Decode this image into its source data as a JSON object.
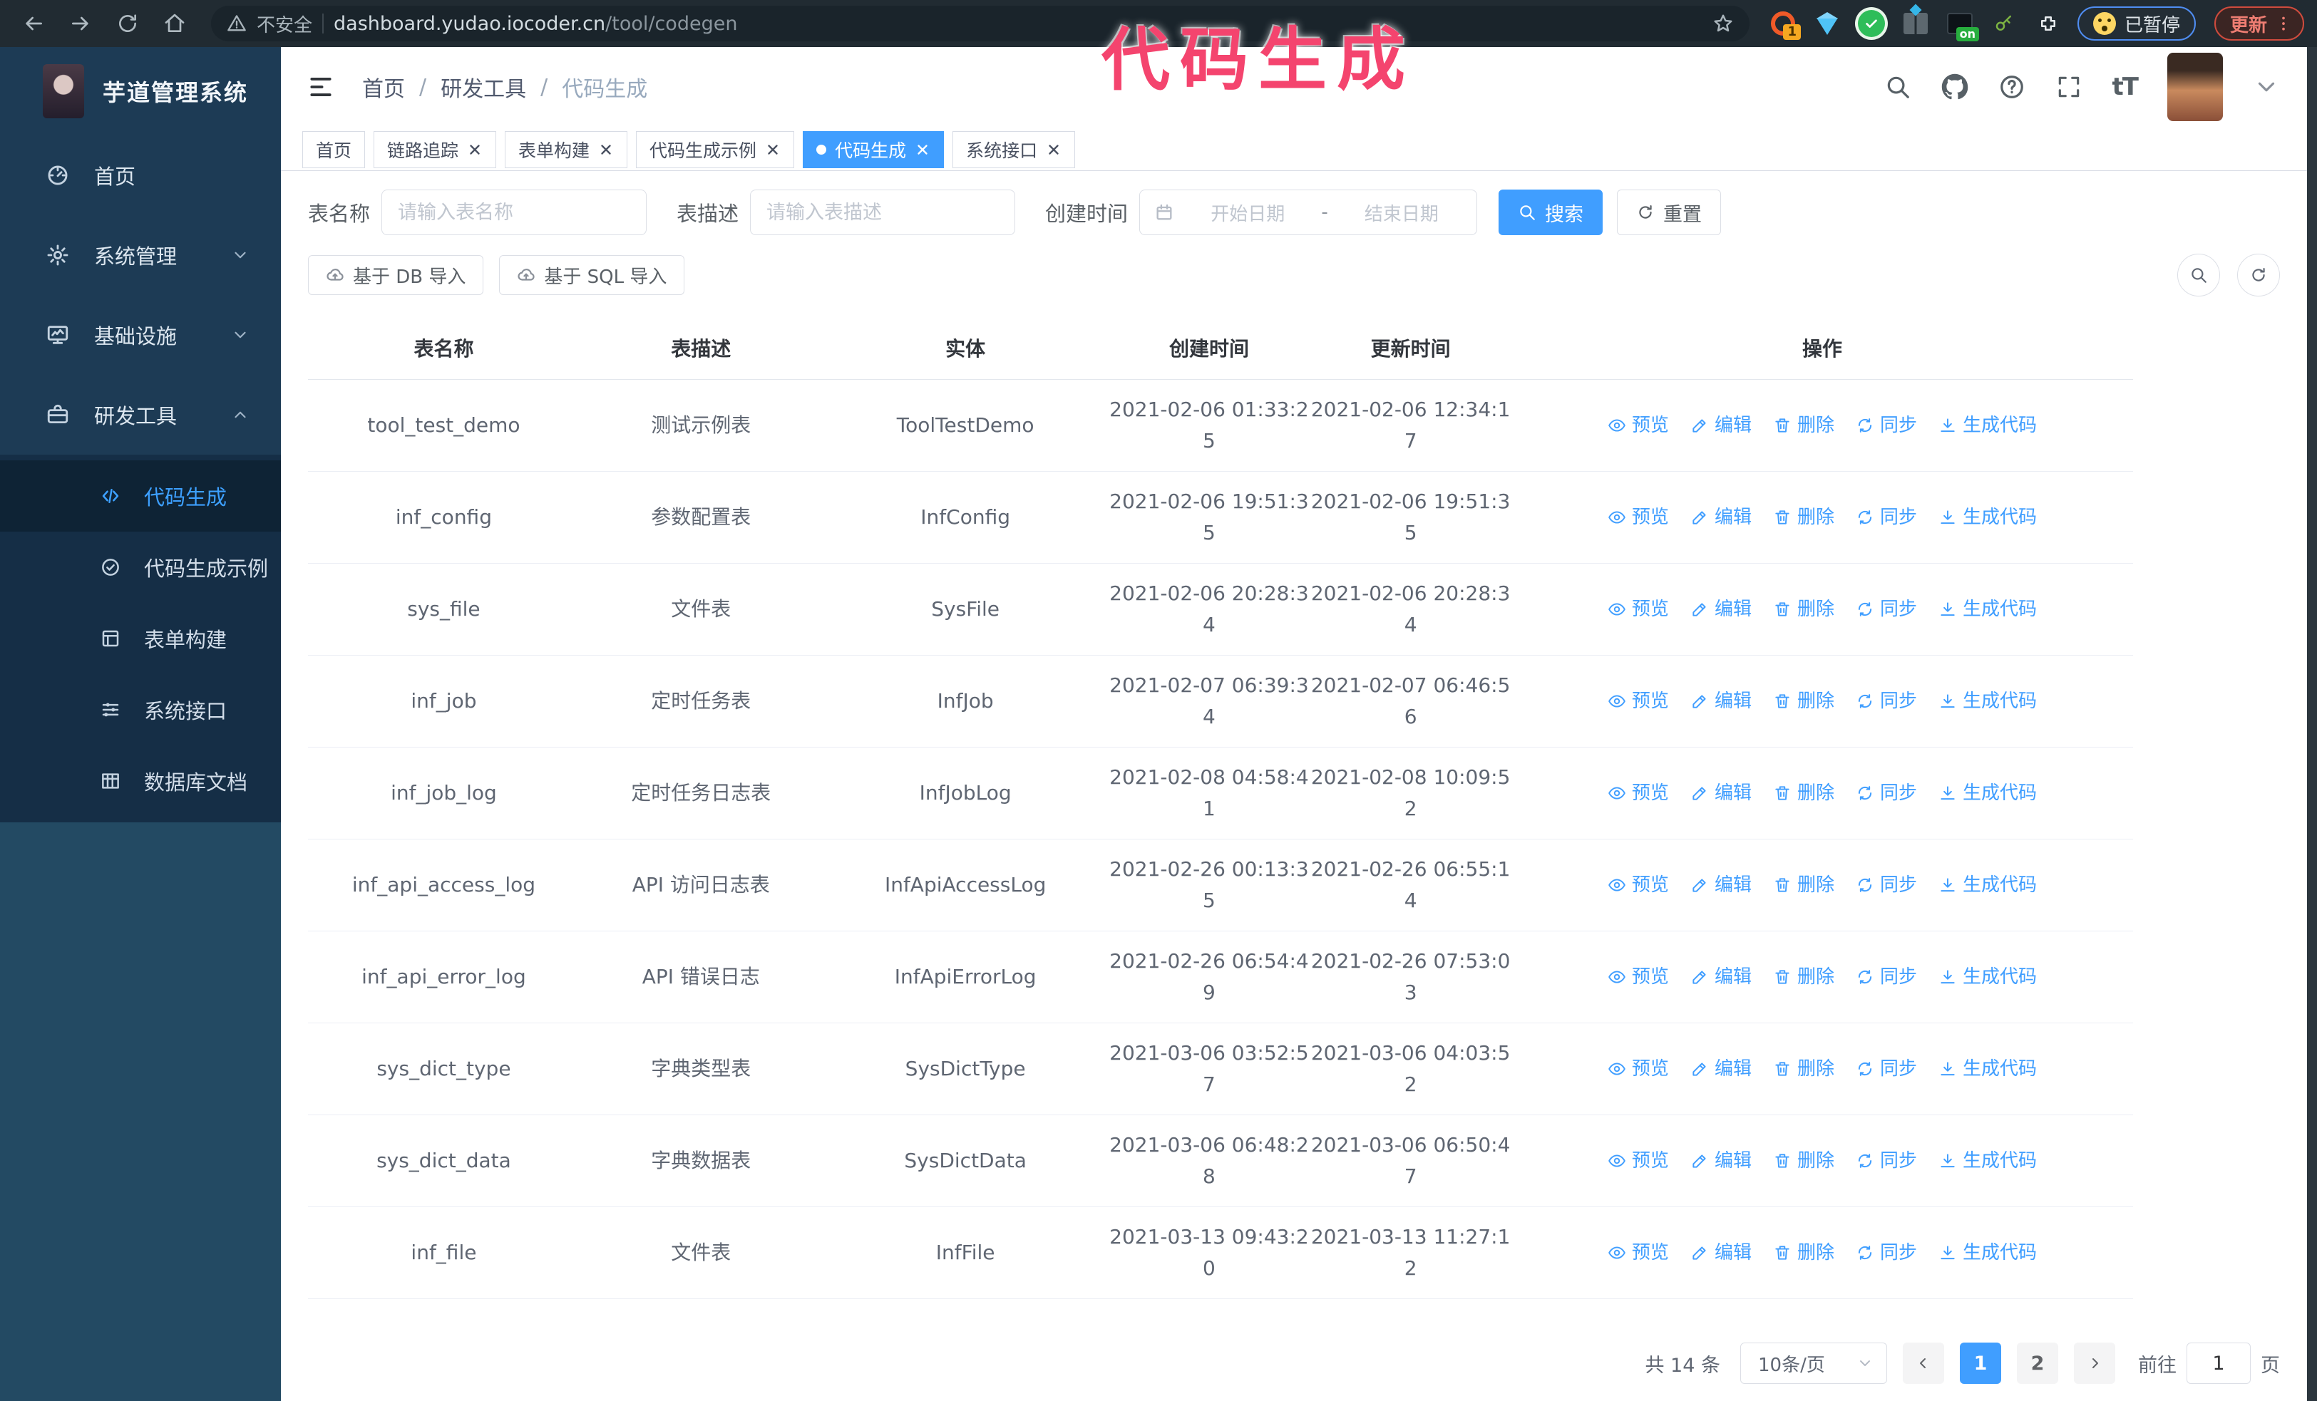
{
  "browser": {
    "security_label": "不安全",
    "url_host": "dashboard.yudao.iocoder.cn",
    "url_path": "/tool/codegen",
    "extension_badge": "1",
    "extension_on_badge": "on",
    "paused_label": "已暂停",
    "update_label": "更新"
  },
  "annotation": {
    "text": "代码生成",
    "color": "#f4446e"
  },
  "sidebar": {
    "logo_title": "芋道管理系统",
    "menu": [
      {
        "label": "首页",
        "icon": "dashboard-icon"
      },
      {
        "label": "系统管理",
        "icon": "gear-icon",
        "chevron": "down"
      },
      {
        "label": "基础设施",
        "icon": "monitor-icon",
        "chevron": "down"
      },
      {
        "label": "研发工具",
        "icon": "toolbox-icon",
        "chevron": "up",
        "expanded": true
      }
    ],
    "submenu": [
      {
        "label": "代码生成",
        "icon": "code-icon",
        "active": true
      },
      {
        "label": "代码生成示例",
        "icon": "check-circle-icon"
      },
      {
        "label": "表单构建",
        "icon": "form-icon"
      },
      {
        "label": "系统接口",
        "icon": "sliders-icon"
      },
      {
        "label": "数据库文档",
        "icon": "grid-icon"
      }
    ]
  },
  "header": {
    "breadcrumb": [
      "首页",
      "研发工具",
      "代码生成"
    ]
  },
  "tabs": [
    {
      "label": "首页",
      "closable": false,
      "active": false
    },
    {
      "label": "链路追踪",
      "closable": true,
      "active": false
    },
    {
      "label": "表单构建",
      "closable": true,
      "active": false
    },
    {
      "label": "代码生成示例",
      "closable": true,
      "active": false
    },
    {
      "label": "代码生成",
      "closable": true,
      "active": true
    },
    {
      "label": "系统接口",
      "closable": true,
      "active": false
    }
  ],
  "search": {
    "name_label": "表名称",
    "name_placeholder": "请输入表名称",
    "desc_label": "表描述",
    "desc_placeholder": "请输入表描述",
    "time_label": "创建时间",
    "start_placeholder": "开始日期",
    "range_separator": "-",
    "end_placeholder": "结束日期",
    "search_button": "搜索",
    "reset_button": "重置"
  },
  "import_toolbar": {
    "db_button": "基于 DB 导入",
    "sql_button": "基于 SQL 导入"
  },
  "table": {
    "columns": [
      "表名称",
      "表描述",
      "实体",
      "创建时间",
      "更新时间",
      "操作"
    ],
    "actions": [
      {
        "label": "预览",
        "icon": "eye-icon"
      },
      {
        "label": "编辑",
        "icon": "edit-icon"
      },
      {
        "label": "删除",
        "icon": "trash-icon"
      },
      {
        "label": "同步",
        "icon": "sync-icon"
      },
      {
        "label": "生成代码",
        "icon": "download-icon"
      }
    ],
    "rows": [
      [
        "tool_test_demo",
        "测试示例表",
        "ToolTestDemo",
        "2021-02-06 01:33:25",
        "2021-02-06 12:34:17"
      ],
      [
        "inf_config",
        "参数配置表",
        "InfConfig",
        "2021-02-06 19:51:35",
        "2021-02-06 19:51:35"
      ],
      [
        "sys_file",
        "文件表",
        "SysFile",
        "2021-02-06 20:28:34",
        "2021-02-06 20:28:34"
      ],
      [
        "inf_job",
        "定时任务表",
        "InfJob",
        "2021-02-07 06:39:34",
        "2021-02-07 06:46:56"
      ],
      [
        "inf_job_log",
        "定时任务日志表",
        "InfJobLog",
        "2021-02-08 04:58:41",
        "2021-02-08 10:09:52"
      ],
      [
        "inf_api_access_log",
        "API 访问日志表",
        "InfApiAccessLog",
        "2021-02-26 00:13:35",
        "2021-02-26 06:55:14"
      ],
      [
        "inf_api_error_log",
        "API 错误日志",
        "InfApiErrorLog",
        "2021-02-26 06:54:49",
        "2021-02-26 07:53:03"
      ],
      [
        "sys_dict_type",
        "字典类型表",
        "SysDictType",
        "2021-03-06 03:52:57",
        "2021-03-06 04:03:52"
      ],
      [
        "sys_dict_data",
        "字典数据表",
        "SysDictData",
        "2021-03-06 06:48:28",
        "2021-03-06 06:50:47"
      ],
      [
        "inf_file",
        "文件表",
        "InfFile",
        "2021-03-13 09:43:20",
        "2021-03-13 11:27:12"
      ]
    ]
  },
  "pagination": {
    "total": "共 14 条",
    "page_size": "10条/页",
    "pages": [
      "1",
      "2"
    ],
    "active_page": "1",
    "goto_label": "前往",
    "goto_value": "1",
    "goto_suffix": "页"
  },
  "colors": {
    "accent": "#409eff",
    "sidebar": "#234a63",
    "submenu": "#152e46"
  }
}
